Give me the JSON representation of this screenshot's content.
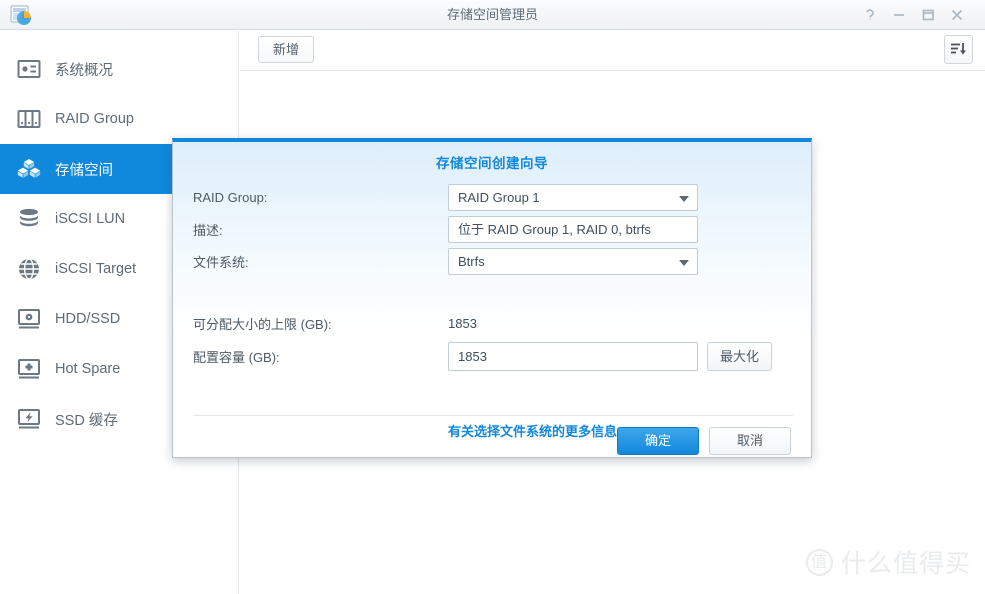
{
  "window": {
    "title": "存储空间管理员",
    "app_icon": "storage-manager-icon",
    "controls": {
      "help": "?",
      "minimize": "—",
      "maximize": "□",
      "close": "✕"
    }
  },
  "sidebar": {
    "items": [
      {
        "label": "系统概况",
        "icon": "overview-icon",
        "selected": false
      },
      {
        "label": "RAID Group",
        "icon": "raid-group-icon",
        "selected": false
      },
      {
        "label": "存储空间",
        "icon": "storage-pool-icon",
        "selected": true
      },
      {
        "label": "iSCSI LUN",
        "icon": "database-icon",
        "selected": false
      },
      {
        "label": "iSCSI Target",
        "icon": "globe-icon",
        "selected": false
      },
      {
        "label": "HDD/SSD",
        "icon": "disk-icon",
        "selected": false
      },
      {
        "label": "Hot Spare",
        "icon": "hot-spare-icon",
        "selected": false
      },
      {
        "label": "SSD 缓存",
        "icon": "ssd-cache-icon",
        "selected": false
      }
    ]
  },
  "toolbar": {
    "add_label": "新增",
    "sort_icon": "sort-descending-icon"
  },
  "dialog": {
    "title": "存储空间创建向导",
    "rows": {
      "raid_group": {
        "label": "RAID Group:",
        "value": "RAID Group 1",
        "control": "dropdown"
      },
      "description": {
        "label": "描述:",
        "value": "位于 RAID Group 1, RAID 0, btrfs",
        "control": "text"
      },
      "file_system": {
        "label": "文件系统:",
        "value": "Btrfs",
        "control": "dropdown"
      },
      "max_allocatable": {
        "label": "可分配大小的上限 (GB):",
        "value": "1853"
      },
      "allocate": {
        "label": "配置容量 (GB):",
        "value": "1853",
        "max_button": "最大化"
      }
    },
    "fs_info_link": "有关选择文件系统的更多信息",
    "actions": {
      "ok": "确定",
      "cancel": "取消"
    }
  },
  "watermark": {
    "badge": "值",
    "text": "什么值得买"
  },
  "colors": {
    "accent": "#1288dc",
    "sidebar_selected": "#1089dd",
    "link": "#1288dc",
    "text": "#4e5a65"
  }
}
